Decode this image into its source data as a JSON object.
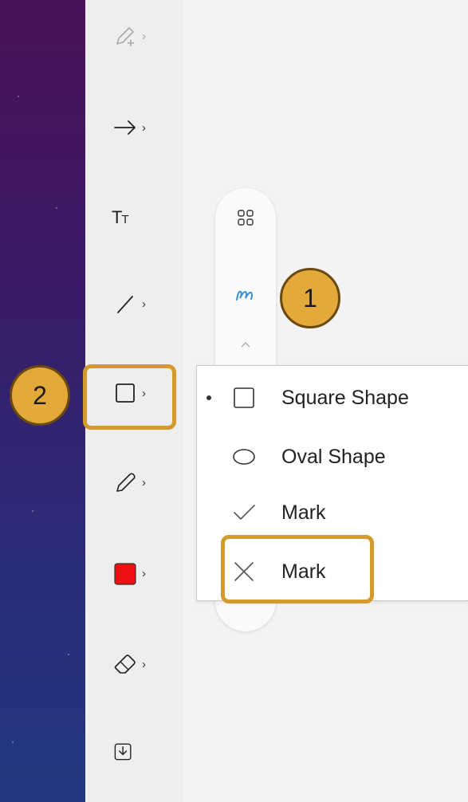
{
  "toolbar": {
    "items": [
      {
        "id": "pen-plus",
        "icon": "pen-plus-icon"
      },
      {
        "id": "arrow",
        "icon": "arrow-right-icon"
      },
      {
        "id": "text",
        "icon": "text-size-icon",
        "label": "T",
        "label_small": "T"
      },
      {
        "id": "line",
        "icon": "line-icon"
      },
      {
        "id": "shape",
        "icon": "square-icon"
      },
      {
        "id": "pencil",
        "icon": "pencil-icon"
      },
      {
        "id": "color",
        "icon": "color-swatch-icon",
        "color": "#ee1111"
      },
      {
        "id": "eraser",
        "icon": "eraser-icon"
      },
      {
        "id": "download",
        "icon": "download-icon"
      }
    ],
    "chevron": "›"
  },
  "pill": {
    "items": [
      {
        "icon": "grid-icon"
      },
      {
        "icon": "ink-squiggle-icon",
        "color": "#3a8fd1"
      },
      {
        "icon": "chevron-up-icon"
      }
    ]
  },
  "shape_menu": {
    "items": [
      {
        "label": "Square Shape",
        "icon": "square-icon",
        "selected": true
      },
      {
        "label": "Oval Shape",
        "icon": "oval-icon",
        "selected": false
      },
      {
        "label": "Mark",
        "icon": "check-icon",
        "selected": false
      },
      {
        "label": "Mark",
        "icon": "x-mark-icon",
        "selected": false
      }
    ]
  },
  "callouts": [
    {
      "number": "1"
    },
    {
      "number": "2"
    }
  ],
  "colors": {
    "callout_fill": "#e3a93a",
    "highlight": "#d49a2e"
  }
}
